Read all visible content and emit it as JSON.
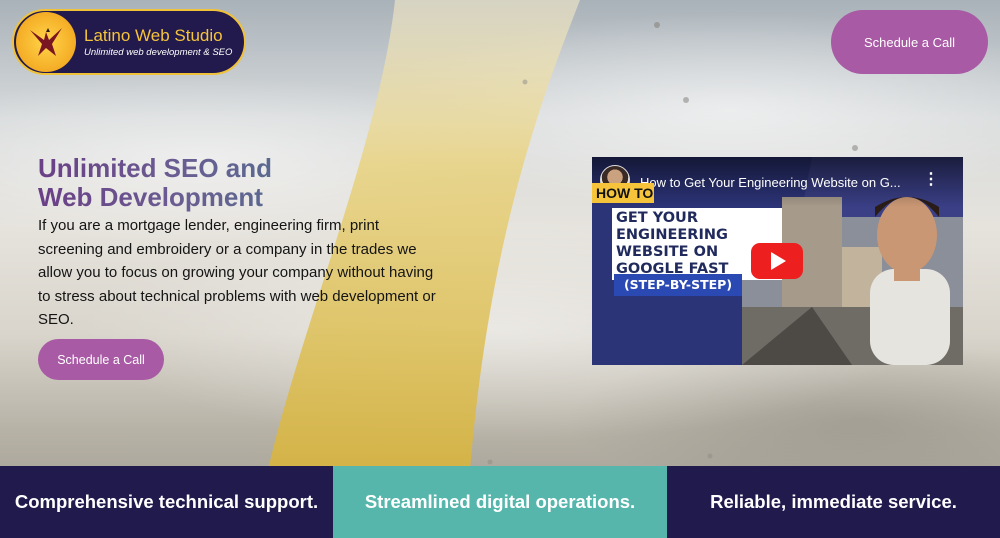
{
  "brand": {
    "name": "Latino Web Studio",
    "tagline": "Unlimited web development & SEO"
  },
  "header": {
    "cta_label": "Schedule a Call"
  },
  "hero": {
    "title_line1": "Unlimited SEO and",
    "title_line2": "Web Development",
    "body": "If you are a mortgage lender, engineering firm, print screening and embroidery or a company in the trades we allow you to focus on growing your company without having to stress about technical problems with web development or SEO.",
    "cta_label": "Schedule a Call"
  },
  "video": {
    "title": "How to Get Your Engineering Website on G...",
    "thumbnail_badge": "HOW TO",
    "thumbnail_headline": "GET YOUR ENGINEERING WEBSITE ON GOOGLE FAST",
    "thumbnail_tag": "(STEP-BY-STEP)",
    "menu_icon": "more-vert-icon",
    "play_icon": "play-icon"
  },
  "features": [
    {
      "label": "Comprehensive technical support."
    },
    {
      "label": "Streamlined digital operations."
    },
    {
      "label": "Reliable, immediate service."
    }
  ],
  "colors": {
    "brand_navy": "#201a4d",
    "accent_gold": "#f5c43b",
    "button_purple": "#a85aa4",
    "teal": "#56b6ac",
    "title_purple": "#6a3f86"
  }
}
